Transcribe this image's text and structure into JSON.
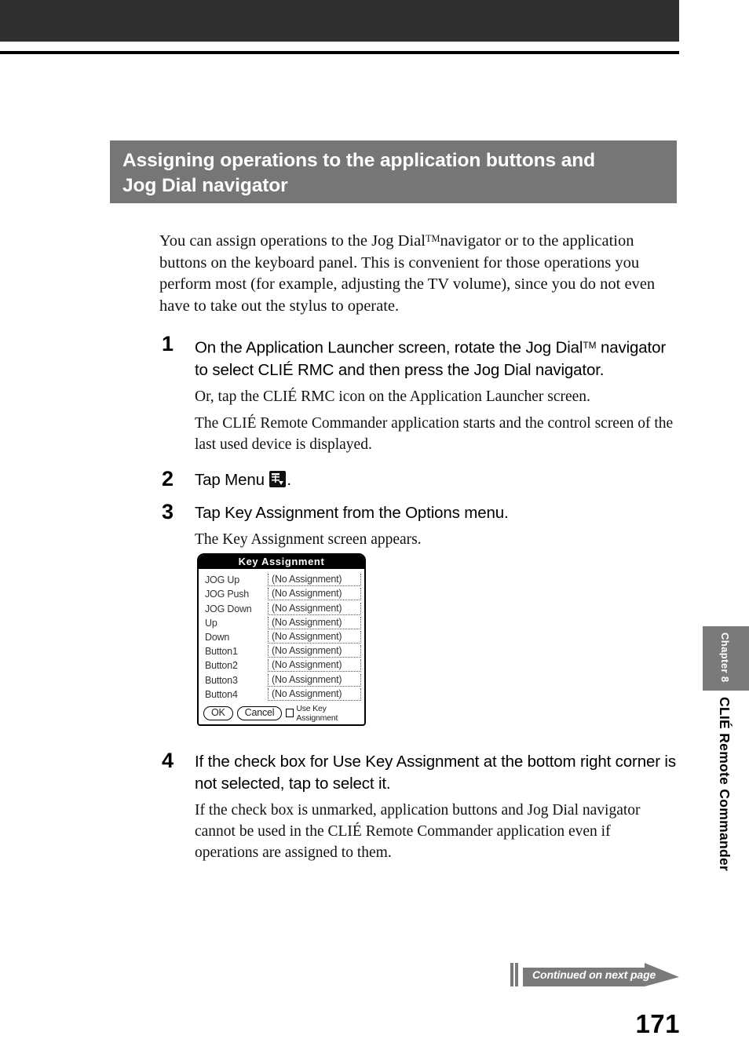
{
  "heading": {
    "line1": "Assigning operations to the application buttons and",
    "line2": "Jog Dial navigator"
  },
  "intro": {
    "part1": "You can assign operations to the Jog Dial",
    "tm": "TM",
    "part2": "navigator or to the application buttons on the keyboard panel. This is convenient for those operations you perform most (for example, adjusting the TV volume), since you do not even have to take out the stylus to operate."
  },
  "steps": [
    {
      "number": "1",
      "title_part1": "On the Application Launcher screen, rotate the Jog Dial",
      "title_tm": "TM",
      "title_part2": " navigator to select CLIÉ RMC and then press the Jog Dial navigator.",
      "body1": "Or, tap the CLIÉ RMC icon on the Application Launcher screen.",
      "body2": "The CLIÉ Remote Commander application starts and the control screen of the last used device is displayed."
    },
    {
      "number": "2",
      "title_part1": "Tap Menu ",
      "title_part2": "."
    },
    {
      "number": "3",
      "title_part1": "Tap Key Assignment from the Options menu.",
      "body1": "The Key Assignment screen appears."
    },
    {
      "number": "4",
      "title_part1": "If the check box for Use Key Assignment at the bottom right corner is not selected, tap to select it.",
      "body1": "If the check box is unmarked, application buttons and Jog Dial navigator cannot be used in the CLIÉ Remote Commander application even if operations are assigned to them."
    }
  ],
  "dialog": {
    "title": "Key Assignment",
    "rows": [
      {
        "label": "JOG Up",
        "value": "(No Assignment)"
      },
      {
        "label": "JOG Push",
        "value": "(No Assignment)"
      },
      {
        "label": "JOG Down",
        "value": "(No Assignment)"
      },
      {
        "label": "Up",
        "value": "(No Assignment)"
      },
      {
        "label": "Down",
        "value": "(No Assignment)"
      },
      {
        "label": "Button1",
        "value": "(No Assignment)"
      },
      {
        "label": "Button2",
        "value": "(No Assignment)"
      },
      {
        "label": "Button3",
        "value": "(No Assignment)"
      },
      {
        "label": "Button4",
        "value": "(No Assignment)"
      }
    ],
    "ok_label": "OK",
    "cancel_label": "Cancel",
    "checkbox_label": "Use Key Assignment",
    "checkbox_checked": false
  },
  "chapter": {
    "tab_label": "Chapter 8",
    "title": "CLIÉ Remote Commander"
  },
  "footer": {
    "continued": "Continued on next page",
    "page_number": "171"
  },
  "colors": {
    "banner_gray": "#767676",
    "tab_gray": "#7a7a7a",
    "top_band": "#303030"
  }
}
